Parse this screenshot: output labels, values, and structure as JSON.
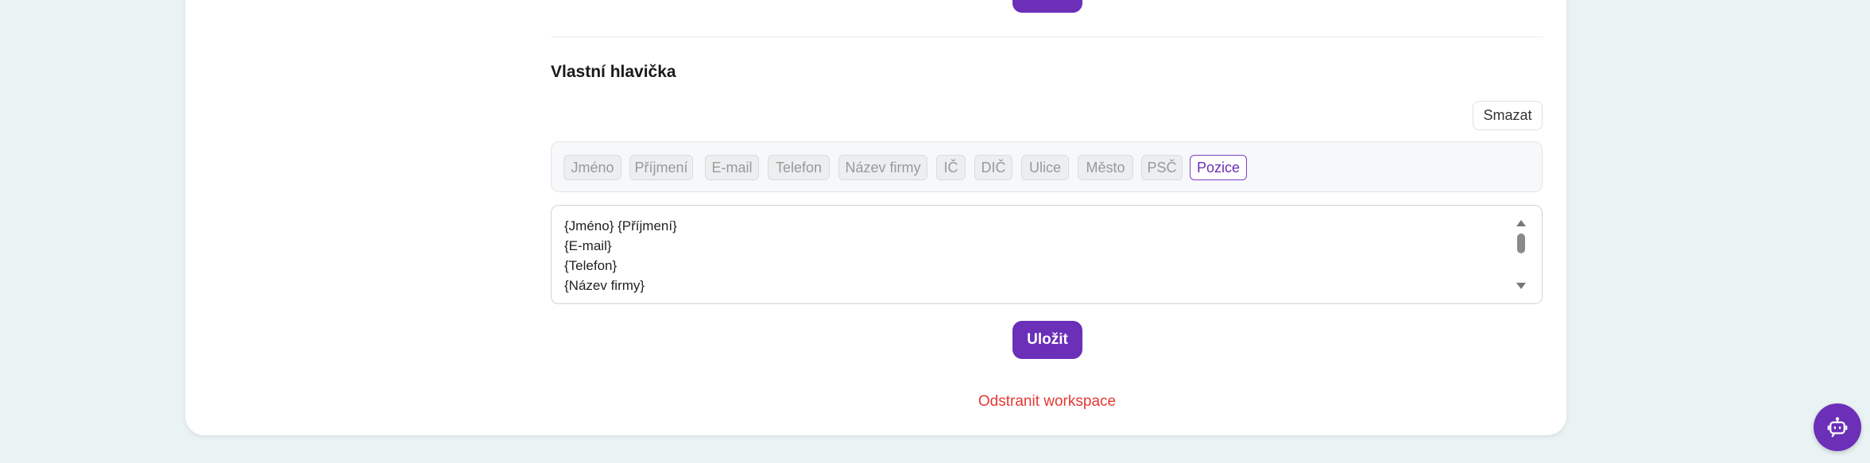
{
  "section": {
    "title": "Vlastní hlavička",
    "clear_label": "Smazat"
  },
  "chips": [
    {
      "label": "Jméno",
      "active": false
    },
    {
      "label": "Příjmení",
      "active": false
    },
    {
      "label": "E-mail",
      "active": false
    },
    {
      "label": "Telefon",
      "active": false
    },
    {
      "label": "Název firmy",
      "active": false
    },
    {
      "label": "IČ",
      "active": false
    },
    {
      "label": "DIČ",
      "active": false
    },
    {
      "label": "Ulice",
      "active": false
    },
    {
      "label": "Město",
      "active": false
    },
    {
      "label": "PSČ",
      "active": false
    },
    {
      "label": "Pozice",
      "active": true
    }
  ],
  "editor": {
    "lines": [
      "{Jméno} {Příjmení}",
      "{E-mail}",
      "{Telefon}",
      "{Název firmy}"
    ]
  },
  "actions": {
    "save_label": "Uložit",
    "delete_label": "Odstranit workspace"
  },
  "colors": {
    "accent": "#6b2fb8",
    "danger": "#e53935"
  },
  "icons": {
    "assistant": "robot-chat-icon"
  }
}
